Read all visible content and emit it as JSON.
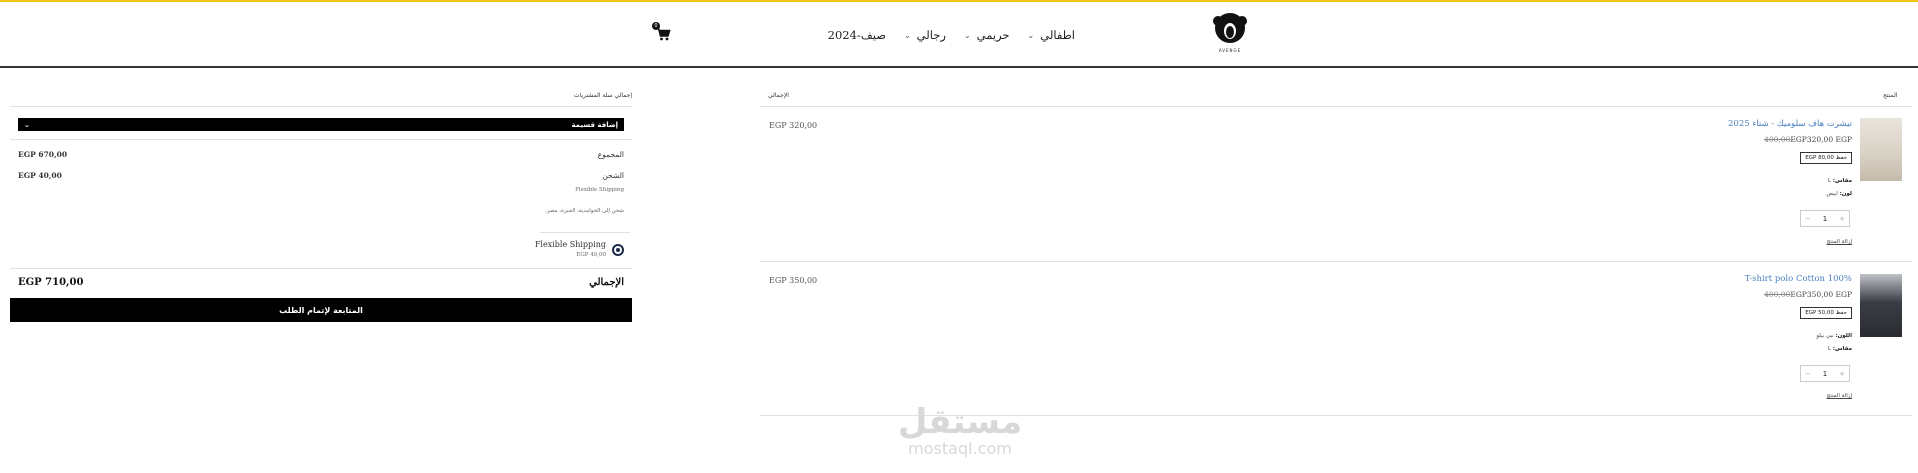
{
  "header": {
    "logo_text": "AVENGE",
    "nav": [
      {
        "label": "اطفالي"
      },
      {
        "label": "حريمي"
      },
      {
        "label": "رجالي"
      },
      {
        "label": "صيف-2024"
      }
    ],
    "cart_count": "0"
  },
  "cart": {
    "col_product": "المنتج",
    "col_total": "الإجمالي",
    "items": [
      {
        "name": "تيشرت هاف سلوميك - شتاء 2025",
        "price_old": "400,00",
        "price_new": "EGP320,00 EGP",
        "save": "حفظ 80,00 EGP",
        "attr1_label": "مقاس:",
        "attr1_value": "L",
        "attr2_label": "لون:",
        "attr2_value": "ابيض",
        "qty": "1",
        "remove": "إزالة المنتج",
        "line_total": "EGP 320,00"
      },
      {
        "name": "T-shirt polo Cotton 100%",
        "price_old": "400,00",
        "price_new": "EGP350,00 EGP",
        "save": "حفظ 50,00 EGP",
        "attr1_label": "اللون:",
        "attr1_value": "نبي بيلو",
        "attr2_label": "مقاس:",
        "attr2_value": "L",
        "qty": "1",
        "remove": "إزالة المنتج",
        "line_total": "EGP 350,00"
      }
    ]
  },
  "summary": {
    "title": "إجمالي سلة المشتريات",
    "coupon_label": "إضافة قسيمة",
    "subtotal_label": "المجموع",
    "subtotal_value": "EGP 670,00",
    "shipping_label": "الشحن",
    "shipping_value": "EGP 40,00",
    "shipping_method": "Flexible Shipping",
    "shipping_to": "شحن إلى الحوامدية، الجيزة، مصر.",
    "option_label": "Flexible Shipping",
    "option_price": "EGP 40,00",
    "total_label": "الإجمالي",
    "total_value": "EGP 710,00",
    "checkout_label": "المتابعة لإتمام الطلب"
  },
  "watermark": {
    "arabic": "مستقل",
    "latin": "mostaql.com"
  },
  "colors": {
    "accent_line": "#f0c419",
    "link": "#4a7fc1",
    "button": "#000000"
  }
}
